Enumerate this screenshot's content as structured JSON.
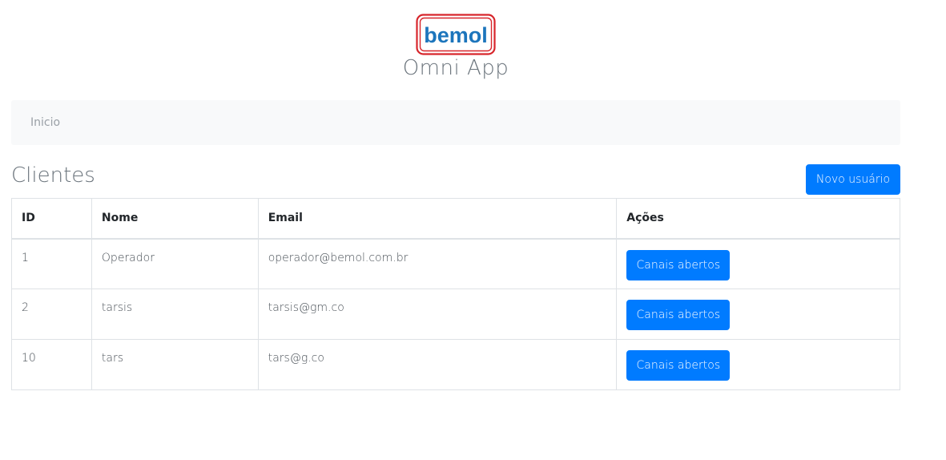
{
  "brand": {
    "logo_text": "bemol",
    "app_title": "Omni App",
    "logo_colors": {
      "text": "#1c75bc",
      "frame": "#d7262c"
    }
  },
  "breadcrumb": {
    "items": [
      {
        "label": "Inicio"
      }
    ]
  },
  "page": {
    "title": "Clientes",
    "new_user_label": "Novo usuário"
  },
  "table": {
    "columns": [
      "ID",
      "Nome",
      "Email",
      "Ações"
    ],
    "rows": [
      {
        "id": "1",
        "name": "Operador",
        "email": "operador@bemol.com.br",
        "action_label": "Canais abertos"
      },
      {
        "id": "2",
        "name": "tarsis",
        "email": "tarsis@gm.co",
        "action_label": "Canais abertos"
      },
      {
        "id": "10",
        "name": "tars",
        "email": "tars@g.co",
        "action_label": "Canais abertos"
      }
    ]
  },
  "colors": {
    "primary": "#007bff",
    "breadcrumb_bg": "#f8f9fa",
    "muted_text": "#6c757d",
    "border": "#dee2e6"
  }
}
